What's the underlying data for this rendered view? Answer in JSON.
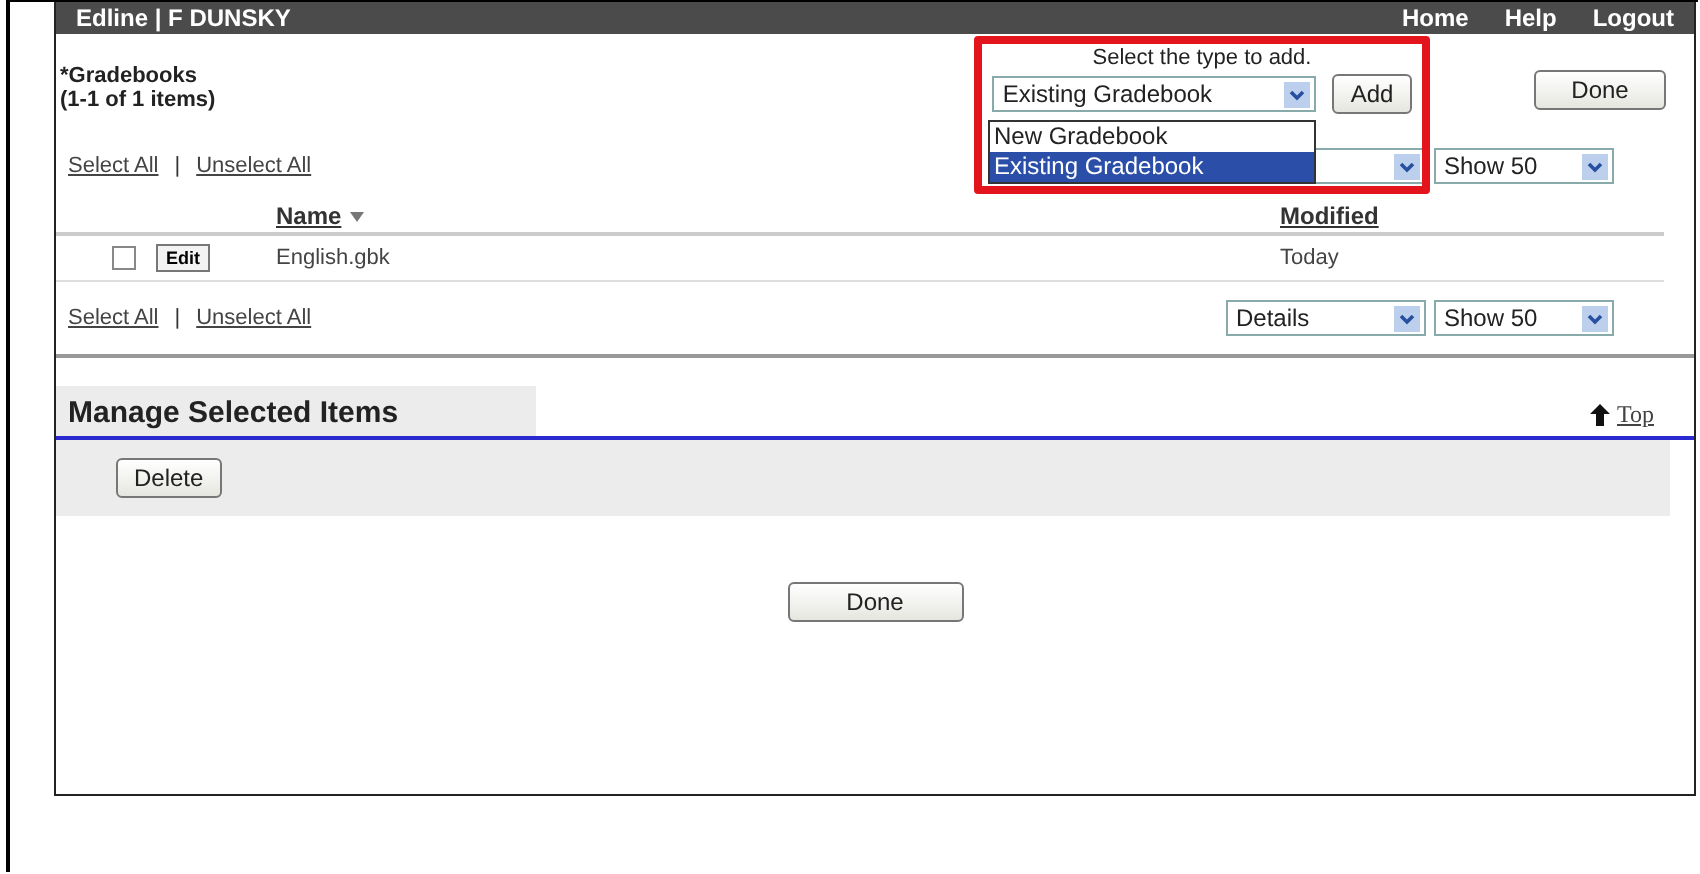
{
  "header": {
    "user": "Edline | F DUNSKY",
    "links": [
      "Home",
      "Help",
      "Logout"
    ]
  },
  "title": "*Gradebooks",
  "count": "(1-1 of 1 items)",
  "add": {
    "caption": "Select the type to add.",
    "value": "Existing Gradebook",
    "button": "Add",
    "highlighted": true,
    "options": [
      {
        "label": "New Gradebook",
        "selected": false
      },
      {
        "label": "Existing Gradebook",
        "selected": true
      }
    ]
  },
  "done_top": "Done",
  "top_bar": {
    "select_all": "Select All",
    "separator": "|",
    "unselect_all": "Unselect All",
    "show": "Show 50"
  },
  "columns": [
    {
      "label": "Name",
      "sorted": true
    },
    {
      "label": "Modified"
    }
  ],
  "rows": [
    {
      "checked": false,
      "edit": "Edit",
      "name": "English.gbk",
      "modified": "Today"
    }
  ],
  "bottom_bar": {
    "select_all": "Select All",
    "separator": "|",
    "unselect_all": "Unselect All",
    "view": "Details",
    "show": "Show 50"
  },
  "manage": {
    "title": "Manage Selected Items",
    "top": "Top",
    "delete": "Delete"
  },
  "done_bottom": "Done"
}
